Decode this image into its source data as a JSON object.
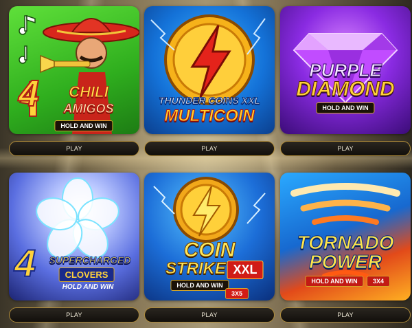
{
  "games": [
    {
      "id": "g1",
      "title_big": "4",
      "title_line1": "CHILI",
      "title_line2": "AMIGOS",
      "subtitle": "HOLD AND WIN",
      "play_label": "PLAY"
    },
    {
      "id": "g2",
      "title_line1": "THUNDER COINS XXL",
      "title_line2": "MULTICOIN",
      "play_label": "PLAY"
    },
    {
      "id": "g3",
      "title_line1": "PURPLE",
      "title_line2": "DIAMOND",
      "subtitle": "HOLD AND WIN",
      "play_label": "PLAY"
    },
    {
      "id": "g4",
      "title_big": "4",
      "title_line1": "SUPERCHARGED",
      "title_line2": "CLOVERS",
      "subtitle": "HOLD AND WIN",
      "play_label": "PLAY"
    },
    {
      "id": "g5",
      "title_line1": "COIN",
      "title_line2": "STRIKE",
      "badge": "XXL",
      "subtitle": "HOLD AND WIN",
      "sub_badge": "3X5",
      "play_label": "PLAY"
    },
    {
      "id": "g6",
      "title_line1": "TORNADO",
      "title_line2": "POWER",
      "subtitle": "HOLD AND WIN",
      "sub_badge": "3X4",
      "play_label": "PLAY"
    }
  ],
  "colors": {
    "play_border": "#b08c3a",
    "play_bg": "#120f0b",
    "accent_gold": "#f2c230"
  },
  "icons": [
    "music-note-icon",
    "trumpet-icon",
    "lightning-bolt-icon",
    "diamond-icon",
    "clover-icon",
    "tornado-icon"
  ]
}
